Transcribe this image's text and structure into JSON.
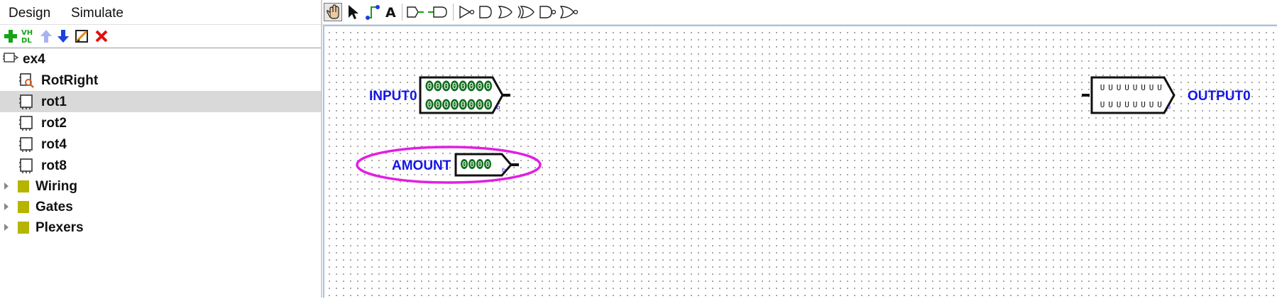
{
  "tabs": {
    "design": "Design",
    "simulate": "Simulate"
  },
  "tree_toolbar": {
    "vhdl_icon_text_top": "VH",
    "vhdl_icon_text_bottom": "DL"
  },
  "tree": {
    "project": "ex4",
    "circuits": [
      "RotRight",
      "rot1",
      "rot2",
      "rot4",
      "rot8"
    ],
    "selected_circuit": "rot1",
    "libraries": [
      "Wiring",
      "Gates",
      "Plexers"
    ]
  },
  "toolbar": {
    "text_tool_glyph": "A"
  },
  "canvas": {
    "input_label": "INPUT0",
    "input_bits_row1": "00000000",
    "input_bits_row2": "00000000",
    "radix_mark": "b",
    "amount_label": "AMOUNT",
    "amount_bits": "0000",
    "output_label": "OUTPUT0",
    "output_bits_row1": "UUUUUUUU",
    "output_bits_row2": "UUUUUUUU",
    "output_radix_mark": "b"
  },
  "colors": {
    "pin_label": "#1515e6",
    "bit_fill": "#0f6d1c",
    "highlight": "#e020e0",
    "selection_border": "#9fc4ea",
    "library_folder": "#b5b500"
  }
}
